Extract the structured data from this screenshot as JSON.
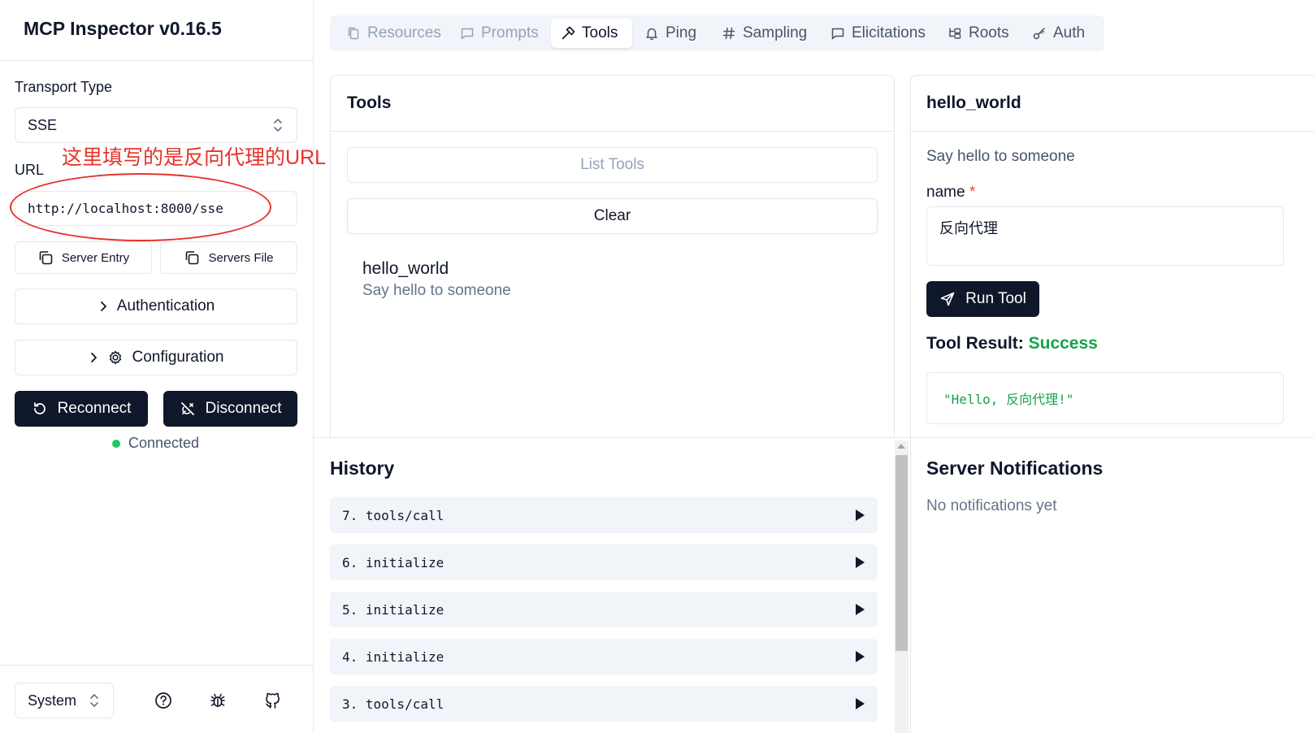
{
  "sidebar": {
    "app_title": "MCP Inspector v0.16.5",
    "transport_type_label": "Transport Type",
    "transport_type_value": "SSE",
    "url_label": "URL",
    "url_value": "http://localhost:8000/sse",
    "annotation_text": "这里填写的是反向代理的URL",
    "server_entry_label": "Server Entry",
    "servers_file_label": "Servers File",
    "authentication_label": "Authentication",
    "configuration_label": "Configuration",
    "reconnect_label": "Reconnect",
    "disconnect_label": "Disconnect",
    "connection_status": "Connected",
    "theme_value": "System",
    "status_color": "#22c55e",
    "annotation_color": "#e5342b"
  },
  "tabs": [
    {
      "label": "Resources",
      "icon": "files-icon",
      "state": "disabled"
    },
    {
      "label": "Prompts",
      "icon": "message-icon",
      "state": "disabled"
    },
    {
      "label": "Tools",
      "icon": "hammer-icon",
      "state": "active"
    },
    {
      "label": "Ping",
      "icon": "bell-icon",
      "state": "enabled"
    },
    {
      "label": "Sampling",
      "icon": "hash-icon",
      "state": "enabled"
    },
    {
      "label": "Elicitations",
      "icon": "message-icon",
      "state": "enabled"
    },
    {
      "label": "Roots",
      "icon": "folder-tree-icon",
      "state": "enabled"
    },
    {
      "label": "Auth",
      "icon": "key-icon",
      "state": "enabled"
    }
  ],
  "tools_panel": {
    "title": "Tools",
    "list_tools_label": "List Tools",
    "clear_label": "Clear",
    "tool": {
      "name": "hello_world",
      "description": "Say hello to someone"
    }
  },
  "tool_detail": {
    "title": "hello_world",
    "description": "Say hello to someone",
    "param_name": "name",
    "required_marker": "*",
    "param_value": "反向代理",
    "run_label": "Run Tool",
    "result_label": "Tool Result:",
    "result_status": "Success",
    "result_value": "\"Hello, 反向代理!\"",
    "success_color": "#16a34a"
  },
  "history": {
    "title": "History",
    "items": [
      "7. tools/call",
      "6. initialize",
      "5. initialize",
      "4. initialize",
      "3. tools/call"
    ]
  },
  "notifications": {
    "title": "Server Notifications",
    "empty_text": "No notifications yet"
  }
}
